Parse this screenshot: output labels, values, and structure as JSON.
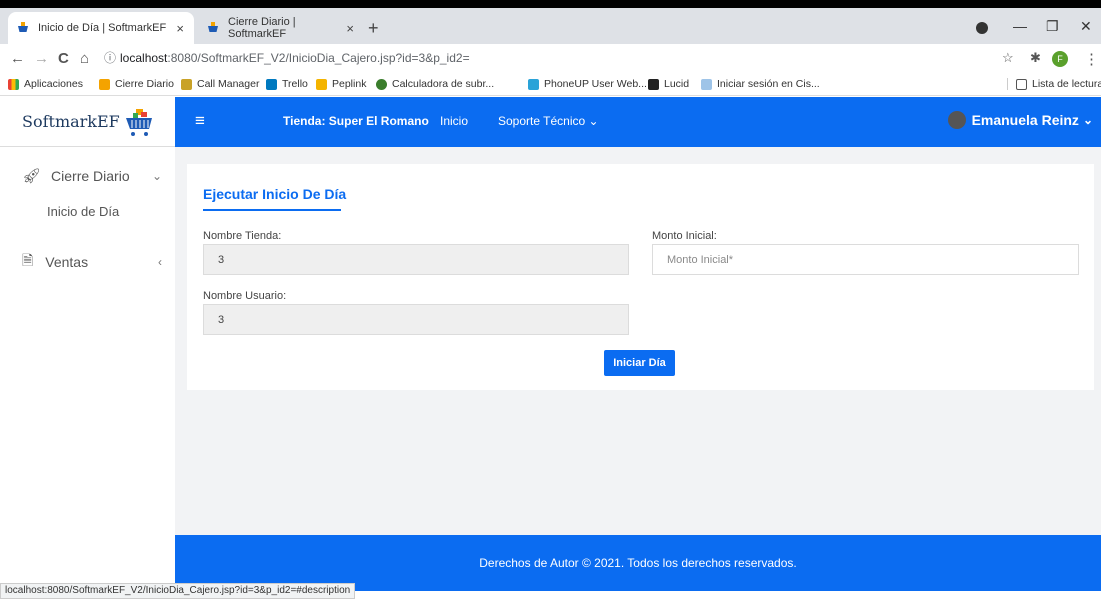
{
  "browser": {
    "tabs": [
      {
        "title": "Inicio de Día | SoftmarkEF",
        "close": "×"
      },
      {
        "title": "Cierre Diario | SoftmarkEF",
        "close": "×"
      }
    ],
    "new_tab": "+",
    "window_controls": {
      "minimize": "—",
      "restore": "❐",
      "close": "✕"
    },
    "nav": {
      "back": "←",
      "forward": "→",
      "reload": "C",
      "home": "⌂",
      "info": "ⓘ"
    },
    "url_host": "localhost",
    "url_rest": ":8080/SoftmarkEF_V2/InicioDia_Cajero.jsp?id=3&p_id2=",
    "profile_initial": "F",
    "bookmarks": [
      "Aplicaciones",
      "Cierre Diario",
      "Call Manager",
      "Trello",
      "Peplink",
      "Calculadora de subr...",
      "PhoneUP User Web...",
      "Lucid",
      "Iniciar sesión en Cis..."
    ],
    "reading_list": "Lista de lectura",
    "status_url": "localhost:8080/SoftmarkEF_V2/InicioDia_Cajero.jsp?id=3&p_id2=#description"
  },
  "app": {
    "brand": "SoftmarkEF",
    "navbar": {
      "menu_icon": "≡",
      "store": "Tienda: Super El Romano",
      "home": "Inicio",
      "support": "Soporte Técnico",
      "support_caret": "⌄",
      "user": "Emanuela Reinz",
      "user_caret": "⌄"
    },
    "sidebar": {
      "items": [
        {
          "label": "Cierre Diario",
          "arrow": "⌄"
        },
        {
          "label": "Ventas",
          "arrow": "‹"
        }
      ],
      "sub_item": "Inicio de Día"
    },
    "card": {
      "title": "Ejecutar Inicio De Día",
      "store_name_label": "Nombre Tienda:",
      "store_name_value": "3",
      "user_name_label": "Nombre Usuario:",
      "user_name_value": "3",
      "initial_amount_label": "Monto Inicial:",
      "initial_amount_placeholder": "Monto Inicial*",
      "submit_label": "Iniciar Día"
    },
    "footer": "Derechos de Autor © 2021. Todos los derechos reservados."
  },
  "colors": {
    "accent": "#0b6cf1",
    "background": "#f2f3f5"
  }
}
